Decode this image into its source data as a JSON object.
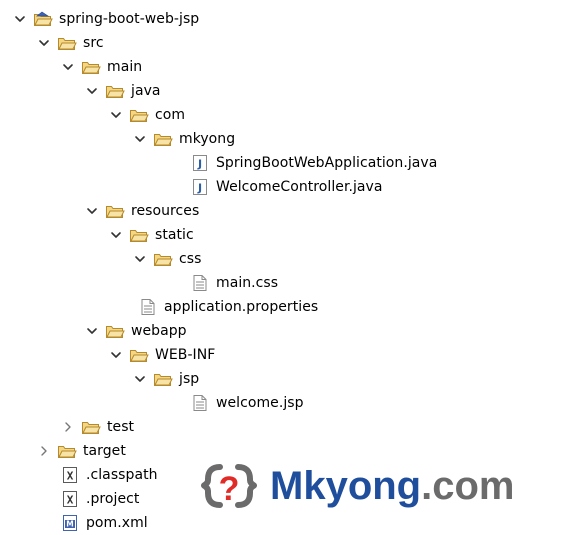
{
  "tree": {
    "items": [
      {
        "label": "spring-boot-web-jsp",
        "icon": "project-folder-icon",
        "expanded": true
      },
      {
        "label": "src",
        "icon": "folder-icon",
        "expanded": true
      },
      {
        "label": "main",
        "icon": "folder-icon",
        "expanded": true
      },
      {
        "label": "java",
        "icon": "folder-icon",
        "expanded": true
      },
      {
        "label": "com",
        "icon": "folder-icon",
        "expanded": true
      },
      {
        "label": "mkyong",
        "icon": "folder-icon",
        "expanded": true
      },
      {
        "label": "SpringBootWebApplication.java",
        "icon": "java-file-icon"
      },
      {
        "label": "WelcomeController.java",
        "icon": "java-file-icon"
      },
      {
        "label": "resources",
        "icon": "folder-icon",
        "expanded": true
      },
      {
        "label": "static",
        "icon": "folder-icon",
        "expanded": true
      },
      {
        "label": "css",
        "icon": "folder-icon",
        "expanded": true
      },
      {
        "label": "main.css",
        "icon": "text-file-icon"
      },
      {
        "label": "application.properties",
        "icon": "text-file-icon"
      },
      {
        "label": "webapp",
        "icon": "folder-icon",
        "expanded": true
      },
      {
        "label": "WEB-INF",
        "icon": "folder-icon",
        "expanded": true
      },
      {
        "label": "jsp",
        "icon": "folder-icon",
        "expanded": true
      },
      {
        "label": "welcome.jsp",
        "icon": "text-file-icon"
      },
      {
        "label": "test",
        "icon": "folder-icon",
        "expanded": false
      },
      {
        "label": "target",
        "icon": "folder-icon",
        "expanded": false
      },
      {
        "label": ".classpath",
        "icon": "xml-file-icon"
      },
      {
        "label": ".project",
        "icon": "xml-file-icon"
      },
      {
        "label": "pom.xml",
        "icon": "maven-file-icon"
      }
    ]
  },
  "logo": {
    "word": "Mkyong",
    "suffix": ".com",
    "mark_text": "?",
    "colors": {
      "brand_blue": "#1f4e9c",
      "brand_red": "#e02b27",
      "mark_gray": "#6b6b6b"
    }
  },
  "colors": {
    "folder_stroke": "#b58a2d",
    "folder_fill": "#f4d683",
    "java_blue": "#2d5ea8",
    "file_gray": "#8a8a8a",
    "xml_gray": "#5a5a5a",
    "maven_blue": "#3f63b0"
  }
}
